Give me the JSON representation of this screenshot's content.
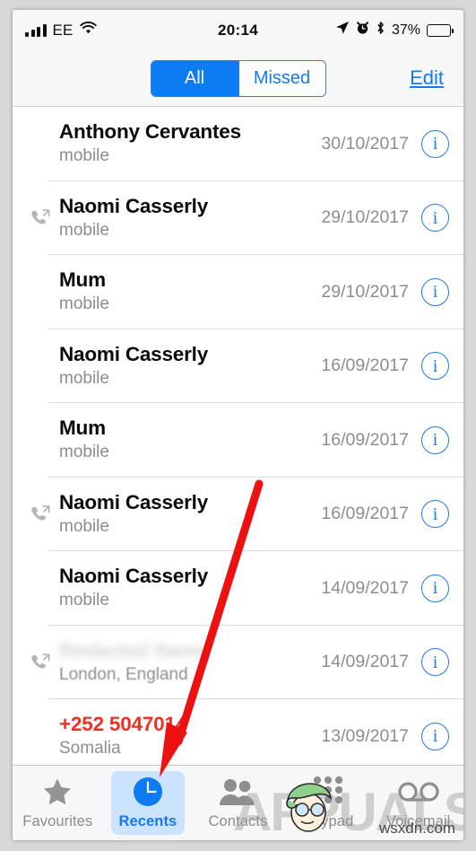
{
  "status_bar": {
    "signal_icon": "signal-bars-icon",
    "signal_bars": 4,
    "carrier": "EE",
    "wifi_icon": "wifi-icon",
    "time": "20:14",
    "location_icon": "location-arrow-icon",
    "alarm_icon": "alarm-clock-icon",
    "bluetooth_icon": "bluetooth-icon",
    "battery_percent": "37%",
    "battery_level": 37,
    "battery_icon": "battery-icon"
  },
  "nav": {
    "segments": [
      {
        "label": "All",
        "selected": true
      },
      {
        "label": "Missed",
        "selected": false
      }
    ],
    "edit_label": "Edit"
  },
  "colors": {
    "accent_blue": "#007AFF",
    "missed_red": "#F03024",
    "secondary_gray": "#8D8D8D",
    "tab_selected_bg": "#CBE3FD",
    "annotation_red": "#EE1111"
  },
  "calls": [
    {
      "name": "Anthony Cervantes",
      "detail": "mobile",
      "date": "30/10/2017",
      "call_type": "none",
      "missed": false,
      "redacted": false
    },
    {
      "name": "Naomi Casserly",
      "detail": "mobile",
      "date": "29/10/2017",
      "call_type": "outgoing",
      "missed": false,
      "redacted": false
    },
    {
      "name": "Mum",
      "detail": "mobile",
      "date": "29/10/2017",
      "call_type": "none",
      "missed": false,
      "redacted": false
    },
    {
      "name": "Naomi Casserly",
      "detail": "mobile",
      "date": "16/09/2017",
      "call_type": "none",
      "missed": false,
      "redacted": false
    },
    {
      "name": "Mum",
      "detail": "mobile",
      "date": "16/09/2017",
      "call_type": "none",
      "missed": false,
      "redacted": false
    },
    {
      "name": "Naomi Casserly",
      "detail": "mobile",
      "date": "16/09/2017",
      "call_type": "outgoing",
      "missed": false,
      "redacted": false
    },
    {
      "name": "Naomi Casserly",
      "detail": "mobile",
      "date": "14/09/2017",
      "call_type": "none",
      "missed": false,
      "redacted": false
    },
    {
      "name": "",
      "detail": "London, England",
      "date": "14/09/2017",
      "call_type": "outgoing",
      "missed": false,
      "redacted": true
    },
    {
      "name": "+252 5047014",
      "detail": "Somalia",
      "date": "13/09/2017",
      "call_type": "none",
      "missed": true,
      "redacted": false
    }
  ],
  "info_button_glyph": "i",
  "tabs": [
    {
      "label": "Favourites",
      "icon": "star-icon",
      "selected": false
    },
    {
      "label": "Recents",
      "icon": "clock-icon",
      "selected": true
    },
    {
      "label": "Contacts",
      "icon": "people-icon",
      "selected": false
    },
    {
      "label": "Keypad",
      "icon": "keypad-dots-icon",
      "selected": false
    },
    {
      "label": "Voicemail",
      "icon": "voicemail-icon",
      "selected": false
    }
  ],
  "annotation": {
    "arrow_icon": "red-arrow-annotation",
    "points_to": "Recents"
  },
  "overlay": {
    "watermark_text": "APPUALS",
    "mascot_icon": "mascot-head-icon",
    "site_tag": "wsxdn.com"
  }
}
